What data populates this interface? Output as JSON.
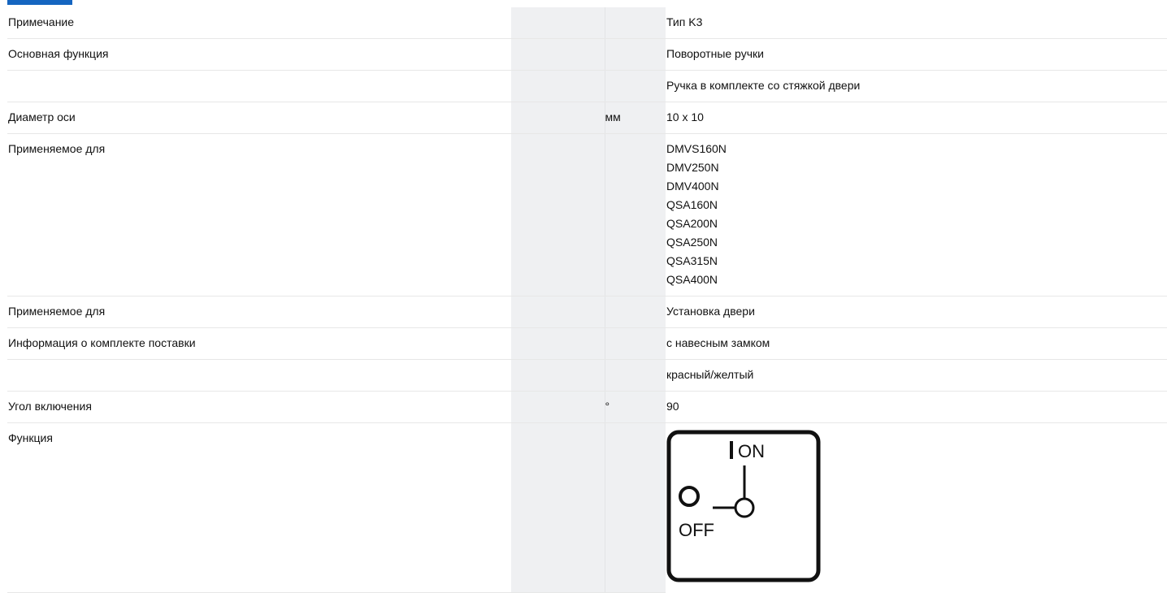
{
  "rows": [
    {
      "label": "Примечание",
      "unit": "",
      "values": [
        "Тип K3"
      ]
    },
    {
      "label": "Основная функция",
      "unit": "",
      "values": [
        "Поворотные ручки"
      ]
    },
    {
      "label": "",
      "unit": "",
      "values": [
        "Ручка в комплекте со стяжкой двери"
      ]
    },
    {
      "label": "Диаметр оси",
      "unit": "мм",
      "values": [
        "10 x 10"
      ]
    },
    {
      "label": "Применяемое для",
      "unit": "",
      "values": [
        "DMVS160N",
        "DMV250N",
        "DMV400N",
        "QSA160N",
        "QSA200N",
        "QSA250N",
        "QSA315N",
        "QSA400N"
      ]
    },
    {
      "label": "Применяемое для",
      "unit": "",
      "values": [
        "Установка двери"
      ]
    },
    {
      "label": "Информация о комплекте поставки",
      "unit": "",
      "values": [
        "с навесным замком"
      ]
    },
    {
      "label": "",
      "unit": "",
      "values": [
        "красный/желтый"
      ]
    },
    {
      "label": "Угол включения",
      "unit": "°",
      "values": [
        "90"
      ]
    },
    {
      "label": "Функция",
      "unit": "",
      "values": []
    }
  ],
  "diagram": {
    "on_label": "ON",
    "off_label": "OFF"
  }
}
